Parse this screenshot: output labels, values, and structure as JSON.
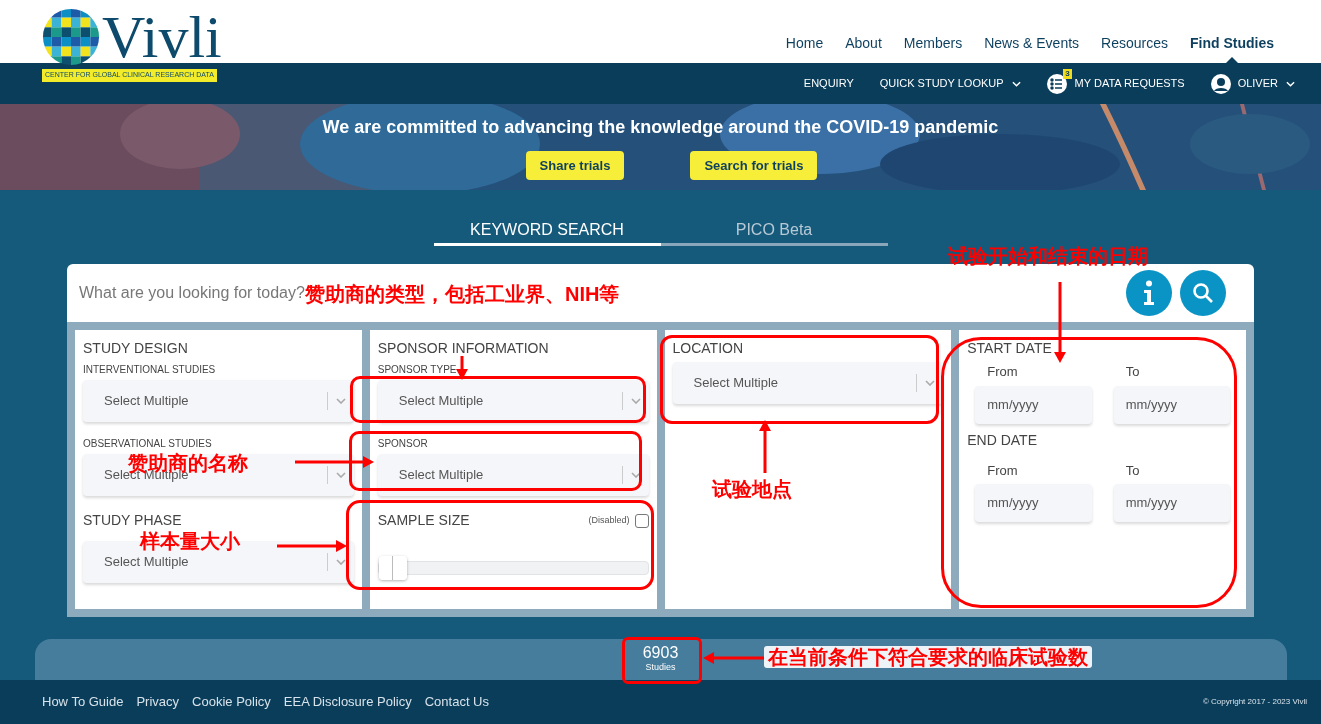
{
  "logo": {
    "name": "Vivli",
    "tagline": "CENTER FOR GLOBAL CLINICAL RESEARCH DATA"
  },
  "main_nav": [
    {
      "label": "Home",
      "selected": false
    },
    {
      "label": "About",
      "selected": false
    },
    {
      "label": "Members",
      "selected": false
    },
    {
      "label": "News & Events",
      "selected": false
    },
    {
      "label": "Resources",
      "selected": false
    },
    {
      "label": "Find Studies",
      "selected": true
    }
  ],
  "sub_nav": [
    {
      "kind": "link",
      "label": "ENQUIRY"
    },
    {
      "kind": "dropdown",
      "label": "QUICK STUDY LOOKUP"
    },
    {
      "kind": "requests",
      "label": "MY DATA REQUESTS",
      "badge": "3"
    },
    {
      "kind": "user",
      "label": "OLIVER"
    }
  ],
  "banner": {
    "title": "We are committed to advancing the knowledge around the COVID-19 pandemic",
    "buttons": [
      "Share trials",
      "Search for trials"
    ]
  },
  "search_tabs": [
    {
      "label": "KEYWORD SEARCH",
      "selected": true
    },
    {
      "label": "PICO Beta",
      "selected": false
    }
  ],
  "search": {
    "placeholder": "What are you looking for today?"
  },
  "panels": [
    {
      "title": "STUDY DESIGN",
      "fields": [
        {
          "kind": "select",
          "label": "INTERVENTIONAL STUDIES",
          "placeholder": "Select Multiple"
        },
        {
          "kind": "select",
          "label": "OBSERVATIONAL STUDIES",
          "placeholder": "Select Multiple"
        },
        {
          "kind": "heading",
          "label": "STUDY PHASE"
        },
        {
          "kind": "select",
          "placeholder": "Select Multiple"
        }
      ]
    },
    {
      "title": "SPONSOR INFORMATION",
      "fields": [
        {
          "kind": "select",
          "label": "SPONSOR TYPE",
          "placeholder": "Select Multiple"
        },
        {
          "kind": "select",
          "label": "SPONSOR",
          "placeholder": "Select Multiple"
        },
        {
          "kind": "slider",
          "label": "SAMPLE SIZE",
          "toggle_label": "(Disabled)",
          "checked": false,
          "level": 0
        }
      ]
    },
    {
      "title": "LOCATION",
      "fields": [
        {
          "kind": "select",
          "placeholder": "Select Multiple"
        }
      ]
    },
    {
      "title": "START DATE",
      "fields": [
        {
          "kind": "date_range",
          "from_label": "From",
          "to_label": "To",
          "from_placeholder": "mm/yyyy",
          "to_placeholder": "mm/yyyy"
        },
        {
          "kind": "heading",
          "label": "END DATE"
        },
        {
          "kind": "date_range",
          "from_label": "From",
          "to_label": "To",
          "from_placeholder": "mm/yyyy",
          "to_placeholder": "mm/yyyy"
        }
      ]
    }
  ],
  "results": {
    "count": "6903",
    "unit": "Studies"
  },
  "footer": {
    "links": [
      "How To Guide",
      "Privacy",
      "Cookie Policy",
      "EEA Disclosure Policy",
      "Contact Us"
    ],
    "copyright": "© Copyright 2017 - 2023 Vivli"
  },
  "annotations": [
    "赞助商的类型，包括工业界、NIH等",
    "赞助商的名称",
    "样本量大小",
    "试验地点",
    "试验开始和结束的日期",
    "在当前条件下符合要求的临床试验数"
  ]
}
